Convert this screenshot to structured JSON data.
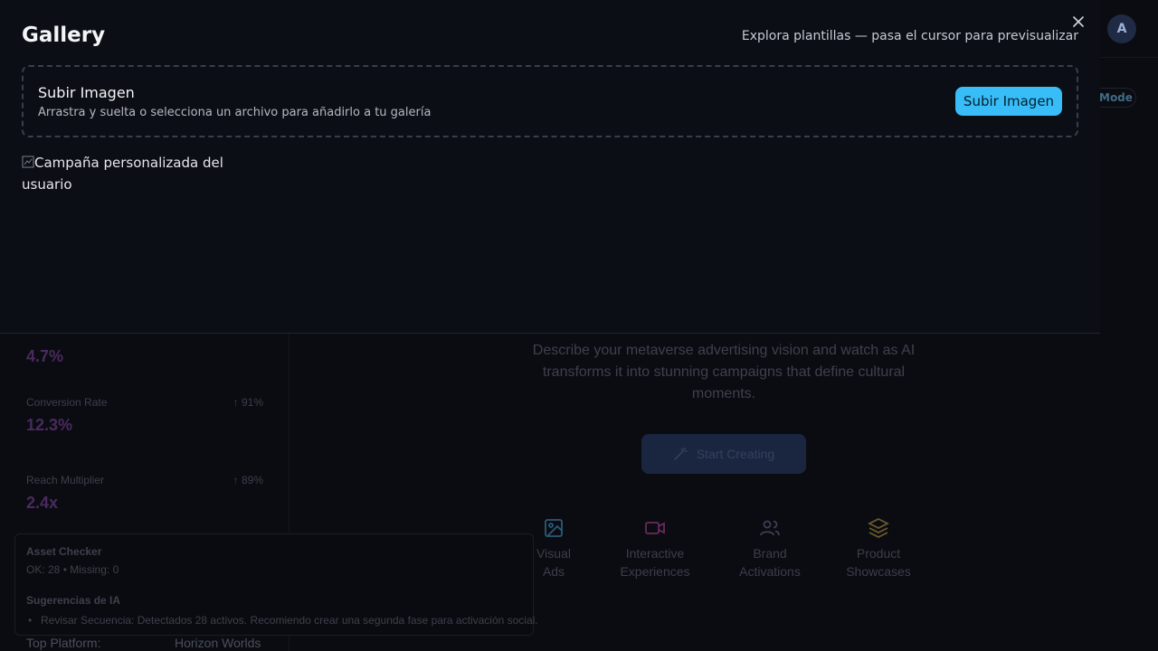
{
  "background": {
    "avatar_initial": "A",
    "mode_button_label": "Mode",
    "metrics": [
      {
        "label": "",
        "delta": "",
        "value": "4.7%"
      },
      {
        "label": "Conversion Rate",
        "delta": "↑ 91%",
        "value": "12.3%"
      },
      {
        "label": "Reach Multiplier",
        "delta": "↑ 89%",
        "value": "2.4x"
      }
    ],
    "hero_description": "Describe your metaverse advertising vision and watch as AI transforms it into stunning campaigns that define cultural moments.",
    "start_button_label": "Start Creating",
    "categories": [
      {
        "icon": "image-icon",
        "label": "Visual Ads",
        "color": "#2b5a78"
      },
      {
        "icon": "video-icon",
        "label": "Interactive Experiences",
        "color": "#6b2a5c"
      },
      {
        "icon": "users-icon",
        "label": "Brand Activations",
        "color": "#3a4152"
      },
      {
        "icon": "layers-icon",
        "label": "Product Showcases",
        "color": "#6a5a2a"
      }
    ],
    "top_platform_label": "Top Platform:",
    "top_platform_value": "Horizon Worlds",
    "asset_checker": {
      "title": "Asset Checker",
      "counts": "OK: 28 • Missing: 0",
      "ai_title": "Sugerencias de IA",
      "suggestions": [
        "Revisar Secuencia: Detectados 28 activos. Recomiendo crear una segunda fase para activación social."
      ]
    }
  },
  "gallery": {
    "title": "Gallery",
    "hint": "Explora plantillas — pasa el cursor para previsualizar",
    "close_icon": "close-icon",
    "dropzone": {
      "title": "Subir Imagen",
      "subtitle": "Arrastra y suelta o selecciona un archivo para añadirlo a tu galería",
      "button_label": "Subir Imagen"
    },
    "items": [
      {
        "alt": "Campaña personalizada del usuario"
      }
    ]
  },
  "colors": {
    "accent": "#38bdf8",
    "overlay_bg": "#0c0e15",
    "metric_value": "#4a2a5e"
  }
}
